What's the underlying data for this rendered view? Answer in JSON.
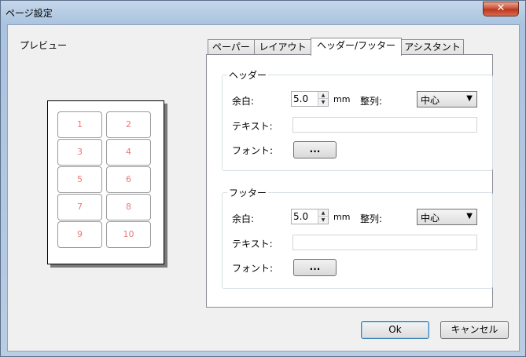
{
  "window": {
    "title": "ページ設定",
    "close_glyph": "✕"
  },
  "preview": {
    "label": "プレビュー",
    "cells": [
      "1",
      "2",
      "3",
      "4",
      "5",
      "6",
      "7",
      "8",
      "9",
      "10"
    ]
  },
  "tabs": [
    {
      "label": "ペーパー",
      "active": false
    },
    {
      "label": "レイアウト",
      "active": false
    },
    {
      "label": "ヘッダー/フッター",
      "active": true
    },
    {
      "label": "アシスタント",
      "active": false
    }
  ],
  "header_group": {
    "title": "ヘッダー",
    "margin_label": "余白:",
    "margin_value": "5.0",
    "unit": "mm",
    "align_label": "整列:",
    "align_value": "中心",
    "text_label": "テキスト:",
    "text_value": "",
    "font_label": "フォント:",
    "font_button": "..."
  },
  "footer_group": {
    "title": "フッター",
    "margin_label": "余白:",
    "margin_value": "5.0",
    "unit": "mm",
    "align_label": "整列:",
    "align_value": "中心",
    "text_label": "テキスト:",
    "text_value": "",
    "font_label": "フォント:",
    "font_button": "..."
  },
  "buttons": {
    "ok": "Ok",
    "cancel": "キャンセル"
  }
}
